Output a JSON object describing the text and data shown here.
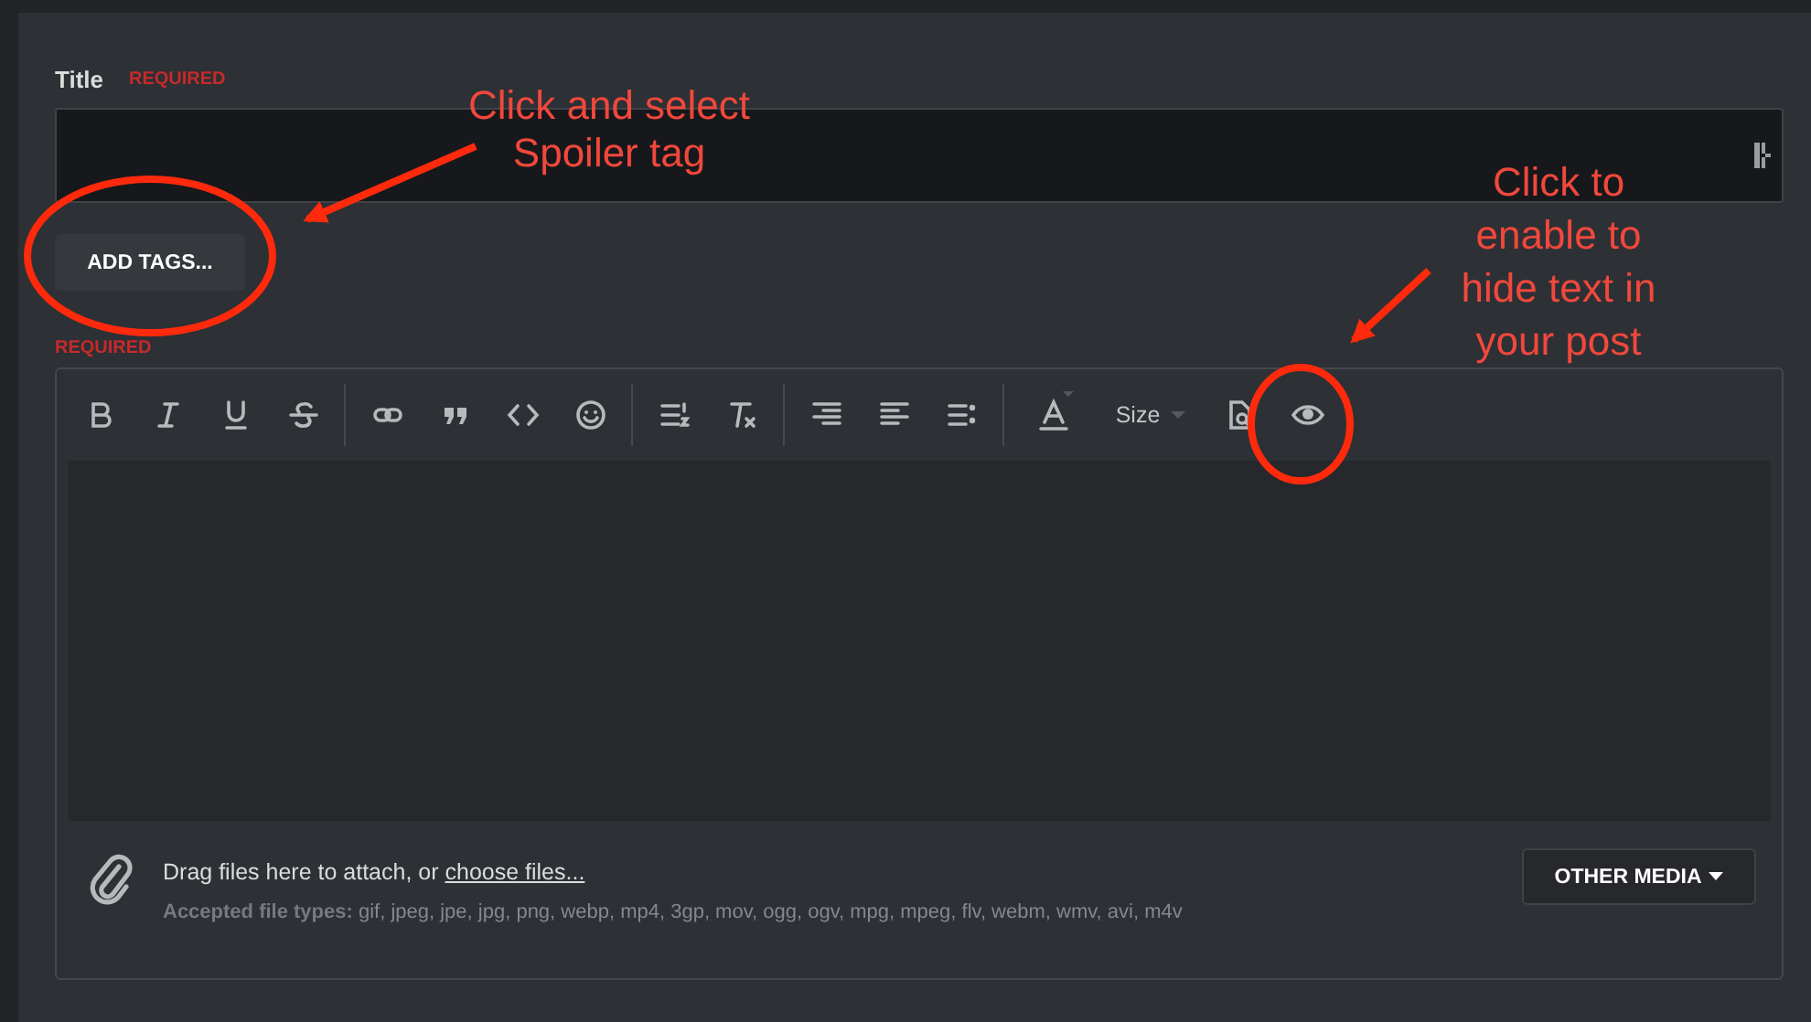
{
  "title_field": {
    "label": "Title",
    "required": "REQUIRED"
  },
  "tags_button": {
    "label": "ADD TAGS..."
  },
  "message_required": "REQUIRED",
  "toolbar": [
    [
      {
        "kind": "bold"
      },
      {
        "kind": "italic"
      },
      {
        "kind": "underline"
      },
      {
        "kind": "strike"
      }
    ],
    [
      {
        "kind": "link"
      },
      {
        "kind": "quote"
      },
      {
        "kind": "code"
      },
      {
        "kind": "smilie"
      }
    ],
    [
      {
        "kind": "numbered-list"
      },
      {
        "kind": "clear-format"
      }
    ],
    [
      {
        "kind": "align-right"
      },
      {
        "kind": "align-left"
      },
      {
        "kind": "bullet-list"
      }
    ],
    [
      {
        "kind": "text-color"
      },
      {
        "kind": "size",
        "label": "Size"
      },
      {
        "kind": "preview"
      },
      {
        "kind": "spoiler"
      }
    ]
  ],
  "attach": {
    "text": "Drag files here to attach, or ",
    "link": "choose files...",
    "types_label": "Accepted file types:",
    "types": " gif, jpeg, jpe, jpg, png, webp, mp4, 3gp, mov, ogg, ogv, mpg, mpeg, flv, webm, wmv, avi, m4v",
    "media_button": "OTHER MEDIA"
  },
  "annotations": [
    {
      "kind": "note",
      "lines": [
        "Click and select",
        "Spoiler tag"
      ]
    },
    {
      "kind": "note",
      "lines": [
        "Click to",
        "enable to",
        "hide text in",
        "your post"
      ]
    }
  ]
}
